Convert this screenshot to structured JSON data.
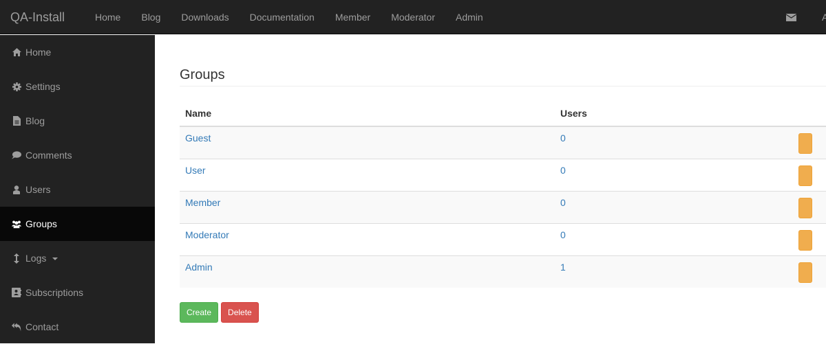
{
  "header": {
    "brand": "QA-Install",
    "nav": [
      {
        "label": "Home"
      },
      {
        "label": "Blog"
      },
      {
        "label": "Downloads"
      },
      {
        "label": "Documentation"
      },
      {
        "label": "Member"
      },
      {
        "label": "Moderator"
      },
      {
        "label": "Admin"
      }
    ],
    "mail_icon": "envelope-icon",
    "user_initial": "A"
  },
  "sidebar": {
    "items": [
      {
        "label": "Home",
        "icon": "home-icon"
      },
      {
        "label": "Settings",
        "icon": "gear-icon"
      },
      {
        "label": "Blog",
        "icon": "file-icon"
      },
      {
        "label": "Comments",
        "icon": "comment-icon"
      },
      {
        "label": "Users",
        "icon": "user-icon"
      },
      {
        "label": "Groups",
        "icon": "users-icon",
        "active": true
      },
      {
        "label": "Logs",
        "icon": "resize-vertical-icon",
        "dropdown": true
      },
      {
        "label": "Subscriptions",
        "icon": "address-book-icon"
      },
      {
        "label": "Contact",
        "icon": "reply-all-icon"
      }
    ]
  },
  "main": {
    "title": "Groups",
    "table": {
      "columns": [
        "Name",
        "Users"
      ],
      "rows": [
        {
          "name": "Guest",
          "users": "0"
        },
        {
          "name": "User",
          "users": "0"
        },
        {
          "name": "Member",
          "users": "0"
        },
        {
          "name": "Moderator",
          "users": "0"
        },
        {
          "name": "Admin",
          "users": "1"
        }
      ]
    },
    "buttons": {
      "create": "Create",
      "delete": "Delete"
    }
  },
  "colors": {
    "navbar": "#222222",
    "active_item": "#080808",
    "link": "#337ab7",
    "success": "#5cb85c",
    "danger": "#d9534f",
    "warning": "#f0ad4e"
  }
}
